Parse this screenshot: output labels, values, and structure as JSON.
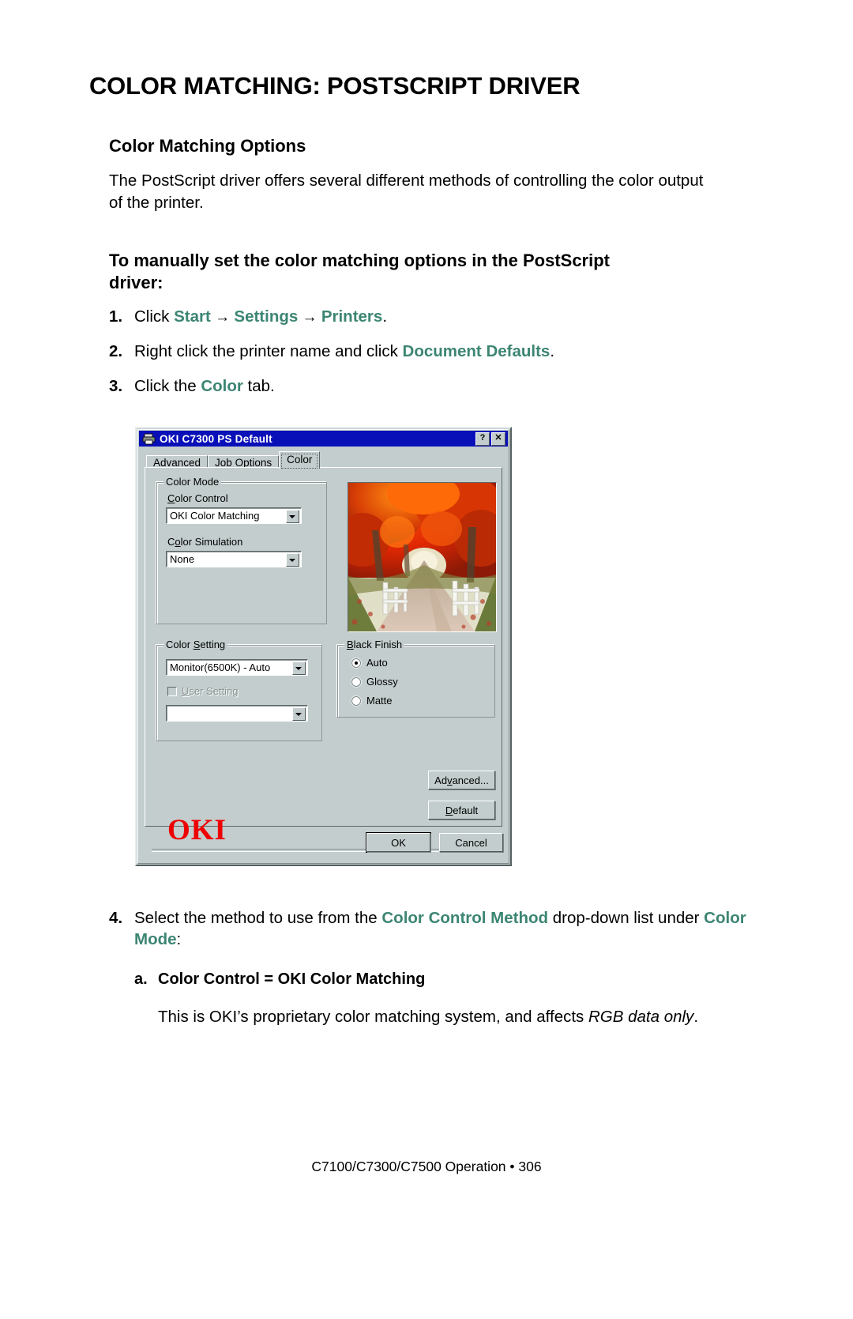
{
  "document": {
    "title": "COLOR MATCHING: POSTSCRIPT DRIVER",
    "section_heading": "Color Matching Options",
    "intro_paragraph": "The PostScript driver offers several different methods of controlling the color output of the printer.",
    "procedure_heading": "To manually set the color matching options in the PostScript driver:",
    "steps": [
      {
        "num": "1.",
        "parts": [
          {
            "text": "Click ",
            "accent": false
          },
          {
            "text": "Start",
            "accent": true
          },
          {
            "text": " → ",
            "accent": false
          },
          {
            "text": "Settings",
            "accent": true
          },
          {
            "text": " → ",
            "accent": false
          },
          {
            "text": "Printers",
            "accent": true
          },
          {
            "text": ".",
            "accent": false
          }
        ]
      },
      {
        "num": "2.",
        "parts": [
          {
            "text": "Right click the printer name and click ",
            "accent": false
          },
          {
            "text": "Document Defaults",
            "accent": true
          },
          {
            "text": ".",
            "accent": false
          }
        ]
      },
      {
        "num": "3.",
        "parts": [
          {
            "text": "Click the ",
            "accent": false
          },
          {
            "text": "Color",
            "accent": true
          },
          {
            "text": " tab.",
            "accent": false
          }
        ]
      }
    ],
    "step4": {
      "num": "4.",
      "text_1": "Select the method to use from the ",
      "accent_1": "Color Control Method",
      "text_2": " drop-down list under ",
      "accent_2": "Color Mode",
      "text_3": ":"
    },
    "substep_a": {
      "letter": "a.",
      "label": "Color Control = OKI Color Matching",
      "body_plain": "This is OKI’s proprietary color matching system, and affects ",
      "body_italic": "RGB data only",
      "body_end": "."
    },
    "footer": "C7100/C7300/C7500  Operation • 306",
    "accent_color": "#3c8573"
  },
  "dialog": {
    "title": "OKI C7300 PS Default",
    "title_icon": "printer-icon",
    "titlebar_color": "#0a10b8",
    "face_color": "#c3cdcd",
    "help_button": "?",
    "close_button": "✕",
    "tabs": [
      {
        "label": "Advanced",
        "active": false
      },
      {
        "label": "Job Options",
        "active": false
      },
      {
        "label": "Color",
        "active": true
      }
    ],
    "color_mode_group": {
      "legend": "Color Mode",
      "color_control_label": "Color Control",
      "color_control_value": "OKI Color Matching",
      "color_simulation_label": "Color Simulation",
      "color_simulation_value": "None"
    },
    "color_setting_group": {
      "legend": "Color Setting",
      "setting_value": "Monitor(6500K) - Auto",
      "user_setting_label": "User Setting",
      "user_setting_checked": false,
      "user_setting_enabled": false,
      "secondary_value": ""
    },
    "black_finish_group": {
      "legend": "Black Finish",
      "options": [
        {
          "label": "Auto",
          "selected": true
        },
        {
          "label": "Glossy",
          "selected": false
        },
        {
          "label": "Matte",
          "selected": false
        }
      ]
    },
    "buttons": {
      "advanced": "Advanced...",
      "default": "Default",
      "ok": "OK",
      "cancel": "Cancel"
    },
    "brand_logo": "OKI",
    "brand_color": "#ef0000",
    "preview_alt": "autumn-trees-country-road-preview"
  }
}
